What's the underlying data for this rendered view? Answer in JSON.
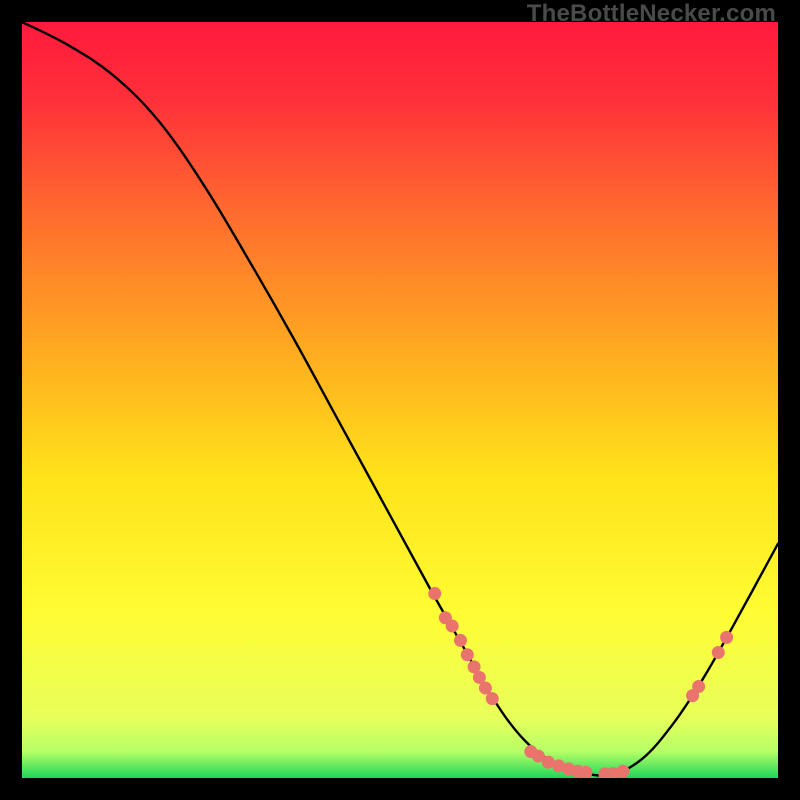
{
  "watermark": "TheBottleNecker.com",
  "chart_data": {
    "type": "line",
    "title": "",
    "xlabel": "",
    "ylabel": "",
    "xlim": [
      0,
      100
    ],
    "ylim": [
      0,
      100
    ],
    "gradient_stops": [
      {
        "offset": 0.0,
        "color": "#ff1a3c"
      },
      {
        "offset": 0.1,
        "color": "#ff2f3a"
      },
      {
        "offset": 0.25,
        "color": "#ff6a2f"
      },
      {
        "offset": 0.45,
        "color": "#ffb01f"
      },
      {
        "offset": 0.6,
        "color": "#ffe21a"
      },
      {
        "offset": 0.78,
        "color": "#fffc33"
      },
      {
        "offset": 0.92,
        "color": "#e8ff5a"
      },
      {
        "offset": 0.965,
        "color": "#b6ff66"
      },
      {
        "offset": 1.0,
        "color": "#1fd65a"
      }
    ],
    "curve": [
      {
        "x": 0.0,
        "y": 100.0
      },
      {
        "x": 6.0,
        "y": 97.0
      },
      {
        "x": 12.0,
        "y": 93.0
      },
      {
        "x": 18.0,
        "y": 87.0
      },
      {
        "x": 24.0,
        "y": 78.5
      },
      {
        "x": 30.0,
        "y": 68.5
      },
      {
        "x": 36.0,
        "y": 58.0
      },
      {
        "x": 42.0,
        "y": 47.0
      },
      {
        "x": 48.0,
        "y": 36.0
      },
      {
        "x": 54.0,
        "y": 25.0
      },
      {
        "x": 58.0,
        "y": 18.0
      },
      {
        "x": 62.0,
        "y": 11.0
      },
      {
        "x": 66.0,
        "y": 5.5
      },
      {
        "x": 70.0,
        "y": 2.2
      },
      {
        "x": 74.0,
        "y": 0.7
      },
      {
        "x": 78.0,
        "y": 0.5
      },
      {
        "x": 82.0,
        "y": 2.5
      },
      {
        "x": 86.0,
        "y": 7.0
      },
      {
        "x": 90.0,
        "y": 13.0
      },
      {
        "x": 94.0,
        "y": 20.0
      },
      {
        "x": 100.0,
        "y": 31.0
      }
    ],
    "marker_color": "#e9746d",
    "marker_radius": 6.5,
    "markers": [
      {
        "x": 54.6,
        "y": 24.4
      },
      {
        "x": 56.0,
        "y": 21.2
      },
      {
        "x": 56.9,
        "y": 20.1
      },
      {
        "x": 58.0,
        "y": 18.2
      },
      {
        "x": 58.9,
        "y": 16.3
      },
      {
        "x": 59.8,
        "y": 14.7
      },
      {
        "x": 60.5,
        "y": 13.3
      },
      {
        "x": 61.3,
        "y": 11.9
      },
      {
        "x": 62.2,
        "y": 10.5
      },
      {
        "x": 67.3,
        "y": 3.5
      },
      {
        "x": 68.3,
        "y": 2.9
      },
      {
        "x": 69.6,
        "y": 2.1
      },
      {
        "x": 71.0,
        "y": 1.6
      },
      {
        "x": 72.3,
        "y": 1.2
      },
      {
        "x": 73.5,
        "y": 0.9
      },
      {
        "x": 74.6,
        "y": 0.75
      },
      {
        "x": 77.1,
        "y": 0.55
      },
      {
        "x": 78.2,
        "y": 0.6
      },
      {
        "x": 79.5,
        "y": 0.9
      },
      {
        "x": 88.7,
        "y": 10.9
      },
      {
        "x": 89.5,
        "y": 12.1
      },
      {
        "x": 92.1,
        "y": 16.6
      },
      {
        "x": 93.2,
        "y": 18.6
      }
    ]
  }
}
